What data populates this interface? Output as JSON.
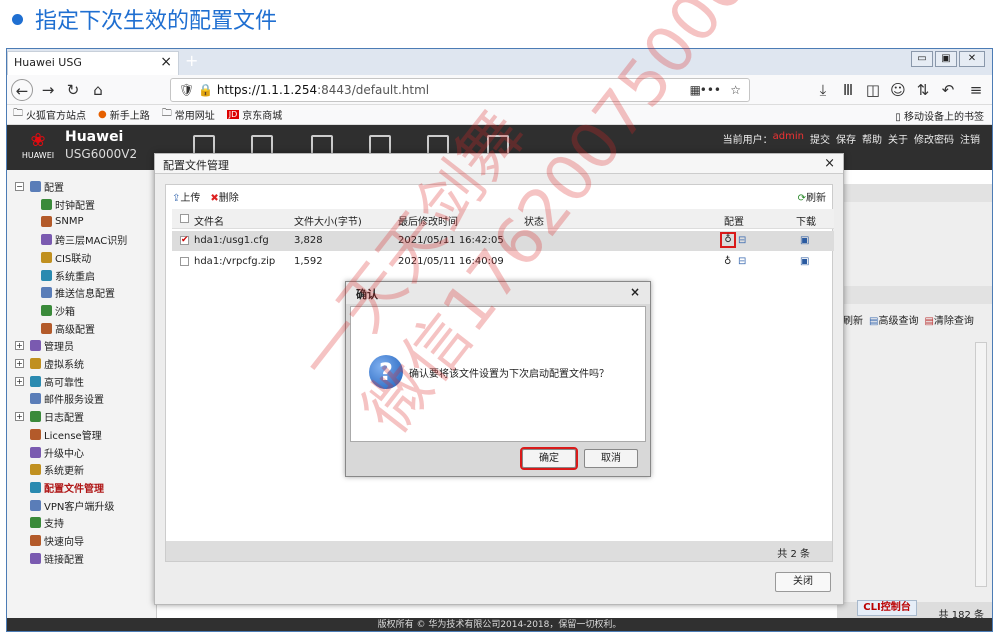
{
  "heading": "指定下次生效的配置文件",
  "browser": {
    "tab_title": "Huawei USG",
    "tab_close": "×",
    "new_tab": "+",
    "url_host": "https://1.1.1.254",
    "url_rest": ":8443/default.html",
    "bookmarks": [
      "火狐官方站点",
      "新手上路",
      "常用网址",
      "京东商城"
    ],
    "mobile_bookmarks": "移动设备上的书签"
  },
  "app": {
    "brand": "Huawei",
    "model": "USG6000V2",
    "logo_text": "HUAWEI",
    "user_label": "当前用户：",
    "user": "admin",
    "actions": [
      "提交",
      "保存",
      "帮助",
      "关于",
      "修改密码",
      "注销"
    ]
  },
  "sidebar": {
    "items": [
      {
        "label": "配置",
        "level": 0,
        "exp": "−"
      },
      {
        "label": "时钟配置",
        "level": 1
      },
      {
        "label": "SNMP",
        "level": 1
      },
      {
        "label": "跨三层MAC识别",
        "level": 1
      },
      {
        "label": "CIS联动",
        "level": 1
      },
      {
        "label": "系统重启",
        "level": 1
      },
      {
        "label": "推送信息配置",
        "level": 1
      },
      {
        "label": "沙箱",
        "level": 1
      },
      {
        "label": "高级配置",
        "level": 1
      },
      {
        "label": "管理员",
        "level": 0,
        "exp": "+"
      },
      {
        "label": "虚拟系统",
        "level": 0,
        "exp": "+"
      },
      {
        "label": "高可靠性",
        "level": 0,
        "exp": "+"
      },
      {
        "label": "邮件服务设置",
        "level": 0
      },
      {
        "label": "日志配置",
        "level": 0,
        "exp": "+"
      },
      {
        "label": "License管理",
        "level": 0
      },
      {
        "label": "升级中心",
        "level": 0
      },
      {
        "label": "系统更新",
        "level": 0
      },
      {
        "label": "配置文件管理",
        "level": 0,
        "active": true
      },
      {
        "label": "VPN客户端升级",
        "level": 0
      },
      {
        "label": "支持",
        "level": 0
      },
      {
        "label": "快速向导",
        "level": 0
      },
      {
        "label": "链接配置",
        "level": 0
      }
    ]
  },
  "right_panel": {
    "refresh": "刷新",
    "advanced_query": "高级查询",
    "clear_query": "清除查询",
    "total": "共 182 条",
    "cli": "CLI控制台"
  },
  "dialog": {
    "title": "配置文件管理",
    "close": "×",
    "upload": "上传",
    "delete": "删除",
    "refresh": "刷新",
    "columns": {
      "name": "文件名",
      "size": "文件大小(字节)",
      "modified": "最后修改时间",
      "status": "状态",
      "config": "配置",
      "download": "下载"
    },
    "rows": [
      {
        "name": "hda1:/usg1.cfg",
        "size": "3,828",
        "modified": "2021/05/11 16:42:05",
        "checked": "✔"
      },
      {
        "name": "hda1:/vrpcfg.zip",
        "size": "1,592",
        "modified": "2021/05/11 16:40:09",
        "checked": ""
      }
    ],
    "total": "共 2 条",
    "close_button": "关闭"
  },
  "confirm": {
    "title": "确认",
    "close": "×",
    "message": "确认要将该文件设置为下次启动配置文件吗？",
    "ok": "确定",
    "cancel": "取消"
  },
  "footer": "版权所有 © 华为技术有限公司2014-2018，保留一切权利。",
  "watermark": [
    "一天天剑舞",
    "微信17620075000"
  ]
}
